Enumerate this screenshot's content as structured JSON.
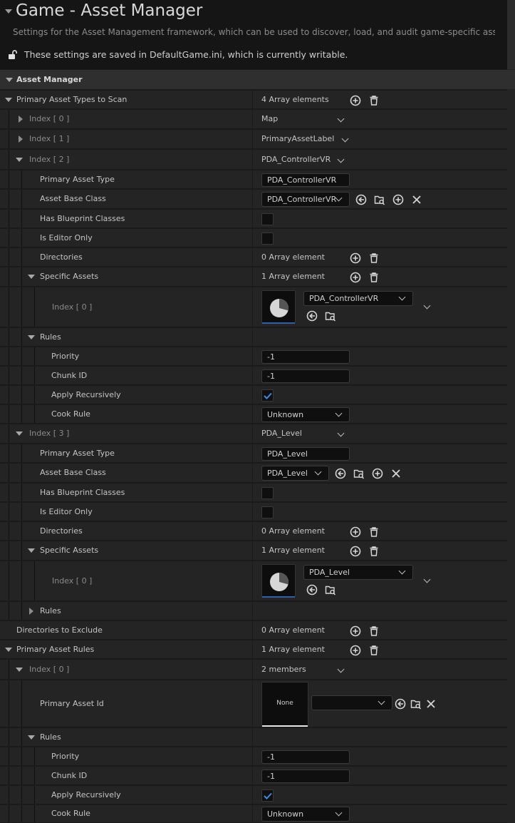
{
  "header": {
    "title": "Game - Asset Manager",
    "description": "Settings for the Asset Management framework, which can be used to discover, load, and audit game-specific asset types",
    "save_status": "These settings are saved in DefaultGame.ini, which is currently writable."
  },
  "section": {
    "title": "Asset Manager"
  },
  "primary_asset_types": {
    "label": "Primary Asset Types to Scan",
    "count": "4 Array elements",
    "index0": {
      "label": "Index [ 0 ]",
      "value": "Map"
    },
    "index1": {
      "label": "Index [ 1 ]",
      "value": "PrimaryAssetLabel"
    },
    "index2": {
      "label": "Index [ 2 ]",
      "value": "PDA_ControllerVR",
      "primary_asset_type_label": "Primary Asset Type",
      "primary_asset_type": "PDA_ControllerVR",
      "asset_base_class_label": "Asset Base Class",
      "asset_base_class": "PDA_ControllerVR",
      "has_blueprint_classes_label": "Has Blueprint Classes",
      "has_blueprint_classes": false,
      "is_editor_only_label": "Is Editor Only",
      "is_editor_only": false,
      "directories_label": "Directories",
      "directories_count": "0 Array element",
      "specific_assets_label": "Specific Assets",
      "specific_assets_count": "1 Array element",
      "specific_index_label": "Index [ 0 ]",
      "specific_asset": "PDA_ControllerVR",
      "rules_label": "Rules",
      "priority_label": "Priority",
      "priority": "-1",
      "chunk_id_label": "Chunk ID",
      "chunk_id": "-1",
      "apply_recursively_label": "Apply Recursively",
      "apply_recursively": true,
      "cook_rule_label": "Cook Rule",
      "cook_rule": "Unknown"
    },
    "index3": {
      "label": "Index [ 3 ]",
      "value": "PDA_Level",
      "primary_asset_type_label": "Primary Asset Type",
      "primary_asset_type": "PDA_Level",
      "asset_base_class_label": "Asset Base Class",
      "asset_base_class": "PDA_Level",
      "has_blueprint_classes_label": "Has Blueprint Classes",
      "has_blueprint_classes": false,
      "is_editor_only_label": "Is Editor Only",
      "is_editor_only": false,
      "directories_label": "Directories",
      "directories_count": "0 Array element",
      "specific_assets_label": "Specific Assets",
      "specific_assets_count": "1 Array element",
      "specific_index_label": "Index [ 0 ]",
      "specific_asset": "PDA_Level",
      "rules_label": "Rules"
    }
  },
  "directories_to_exclude": {
    "label": "Directories to Exclude",
    "count": "0 Array element"
  },
  "primary_asset_rules": {
    "label": "Primary Asset Rules",
    "count": "1 Array element",
    "index0": {
      "label": "Index [ 0 ]",
      "value": "2 members",
      "primary_asset_id_label": "Primary Asset Id",
      "primary_asset_id_thumb": "None",
      "rules_label": "Rules",
      "priority_label": "Priority",
      "priority": "-1",
      "chunk_id_label": "Chunk ID",
      "chunk_id": "-1",
      "apply_recursively_label": "Apply Recursively",
      "apply_recursively": true,
      "cook_rule_label": "Cook Rule",
      "cook_rule": "Unknown"
    }
  },
  "colors": {
    "accent": "#2f5faa",
    "check": "#3c8ce7",
    "panel": "#242424",
    "background": "#1a1a1a"
  }
}
